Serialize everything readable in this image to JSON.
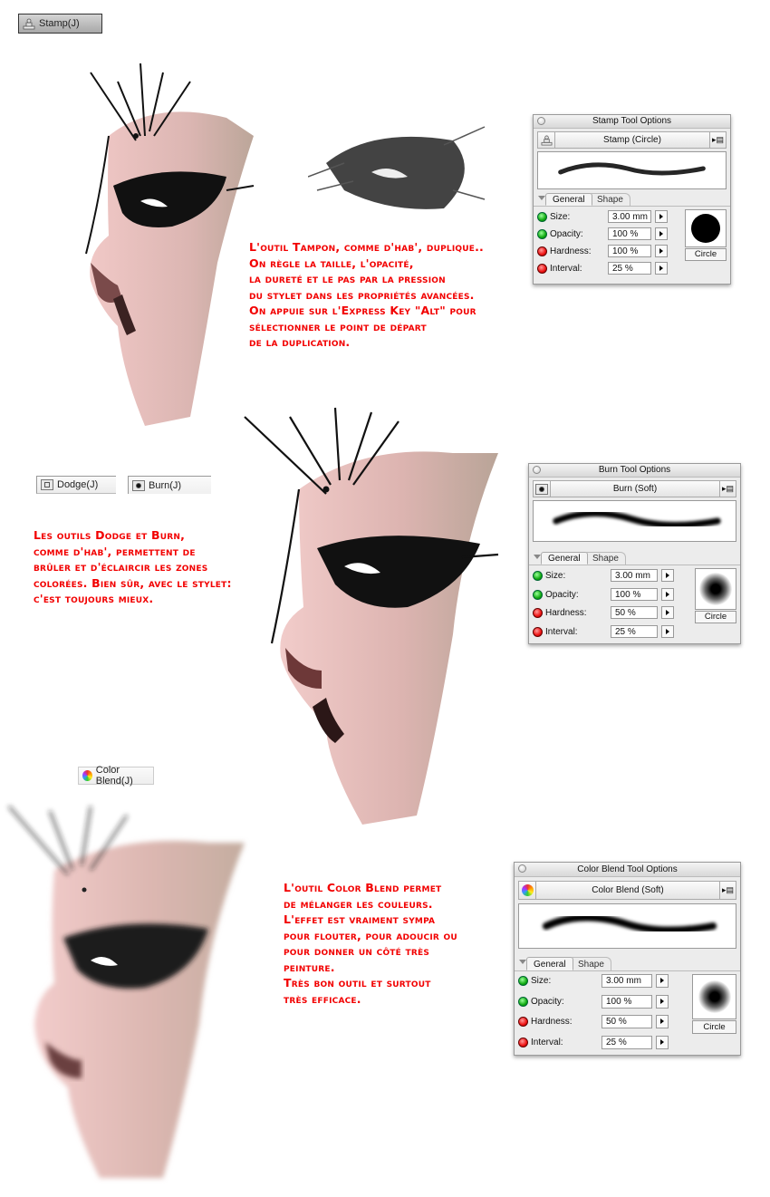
{
  "tool_buttons": {
    "stamp": {
      "label": "Stamp(J)",
      "icon": "stamp-icon"
    },
    "dodge": {
      "label": "Dodge(J)",
      "icon": "dodge-icon"
    },
    "burn": {
      "label": "Burn(J)",
      "icon": "burn-icon"
    },
    "color_blend": {
      "label": "Color Blend(J)",
      "icon": "color-blend-icon"
    }
  },
  "captions": {
    "stamp": "L'outil Tampon, comme d'hab', duplique..\nOn règle la taille, l'opacité,\nla dureté et le pas par la pression\ndu stylet dans les propriétés avancées.\nOn appuie sur l'Express Key \"Alt\" pour\nsélectionner le point de départ\nde la duplication.",
    "dodge_burn": "Les outils Dodge et Burn,\ncomme d'hab', permettent de\nbrûler et d'éclaircir les zones\ncolorées. Bien sûr, avec le stylet:\nc'est toujours mieux.",
    "color_blend": "L'outil Color Blend permet\nde mélanger les couleurs.\nL'effet est vraiment sympa\npour flouter, pour adoucir ou\npour donner un côté très\npeinture.\nTrès bon outil et surtout\ntrès efficace."
  },
  "panels": {
    "stamp": {
      "title": "Stamp Tool Options",
      "preset": "Stamp (Circle)",
      "tabs": [
        "General",
        "Shape"
      ],
      "rows": [
        {
          "label": "Size:",
          "value": "3.00 mm",
          "status": "green"
        },
        {
          "label": "Opacity:",
          "value": "100 %",
          "status": "green"
        },
        {
          "label": "Hardness:",
          "value": "100 %",
          "status": "red"
        },
        {
          "label": "Interval:",
          "value": "25 %",
          "status": "red"
        }
      ],
      "tip_shape": "Circle",
      "tip_type": "hard"
    },
    "burn": {
      "title": "Burn Tool Options",
      "preset": "Burn (Soft)",
      "tabs": [
        "General",
        "Shape"
      ],
      "rows": [
        {
          "label": "Size:",
          "value": "3.00 mm",
          "status": "green"
        },
        {
          "label": "Opacity:",
          "value": "100 %",
          "status": "green"
        },
        {
          "label": "Hardness:",
          "value": "50 %",
          "status": "red"
        },
        {
          "label": "Interval:",
          "value": "25 %",
          "status": "red"
        }
      ],
      "tip_shape": "Circle",
      "tip_type": "soft"
    },
    "color_blend": {
      "title": "Color Blend Tool Options",
      "preset": "Color Blend (Soft)",
      "tabs": [
        "General",
        "Shape"
      ],
      "rows": [
        {
          "label": "Size:",
          "value": "3.00 mm",
          "status": "green"
        },
        {
          "label": "Opacity:",
          "value": "100 %",
          "status": "green"
        },
        {
          "label": "Hardness:",
          "value": "50 %",
          "status": "red"
        },
        {
          "label": "Interval:",
          "value": "25 %",
          "status": "red"
        }
      ],
      "tip_shape": "Circle",
      "tip_type": "soft"
    }
  },
  "colors": {
    "caption_red": "#f20000",
    "skin_pink": "#e8b8b4",
    "skin_tan": "#b9a294",
    "ink": "#111111"
  }
}
